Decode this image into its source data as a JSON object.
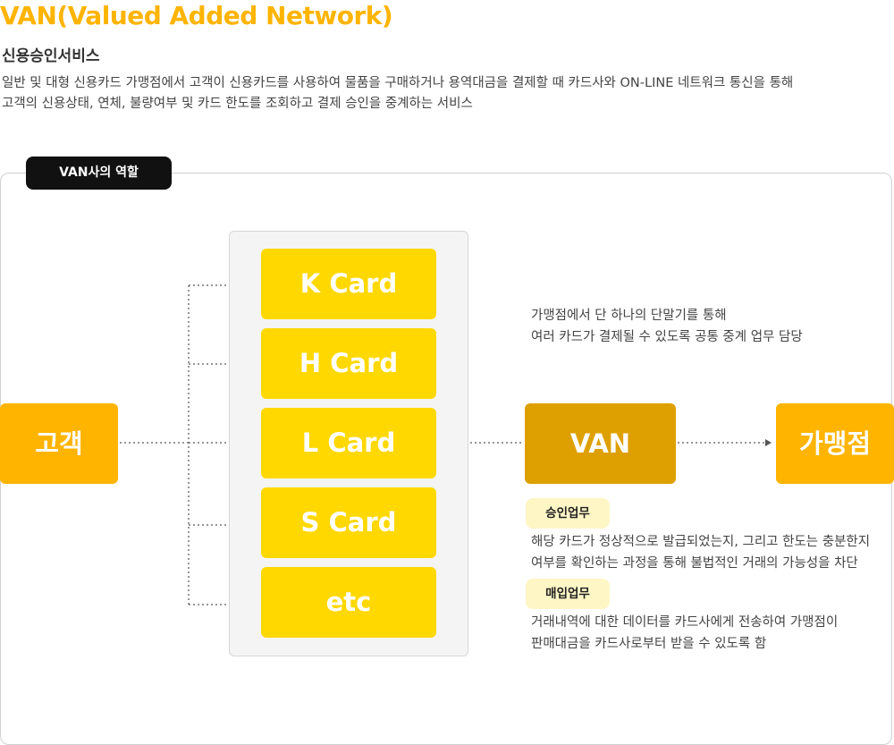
{
  "header": {
    "title": "VAN(Valued Added Network)",
    "subtitle": "신용승인서비스",
    "description": [
      "일반 및 대형 신용카드 가맹점에서 고객이 신용카드를 사용하여 물품을 구매하거나 용역대금을 결제할 때 카드사와 ON-LINE 네트워크 통신을 통해",
      "고객의 신용상태, 연체, 불량여부 및 카드 한도를 조회하고 결제 승인을 중계하는 서비스"
    ]
  },
  "role_tag": "VAN사의 역할",
  "customer": "고객",
  "cards": [
    "K Card",
    "H Card",
    "L Card",
    "S Card",
    "etc"
  ],
  "van": {
    "label": "VAN",
    "description": [
      "가맹점에서 단 하나의 단말기를 통해",
      "여러 카드가 결제될 수 있도록 공통 중계 업무 담당"
    ]
  },
  "merchant": "가맹점",
  "duties": [
    {
      "tag": "승인업무",
      "lines": [
        "해당 카드가 정상적으로 발급되었는지, 그리고 한도는 충분한지",
        "여부를 확인하는 과정을 통해 불법적인 거래의 가능성을 차단"
      ]
    },
    {
      "tag": "매입업무",
      "lines": [
        "거래내역에 대한 데이터를 카드사에게 전송하여 가맹점이",
        "판매대금을 카드사로부터 받을 수 있도록 함"
      ]
    }
  ],
  "colors": {
    "accent": "#ffb400",
    "card": "#ffd800",
    "van": "#dea000",
    "tag_bg": "#fff6c6"
  }
}
